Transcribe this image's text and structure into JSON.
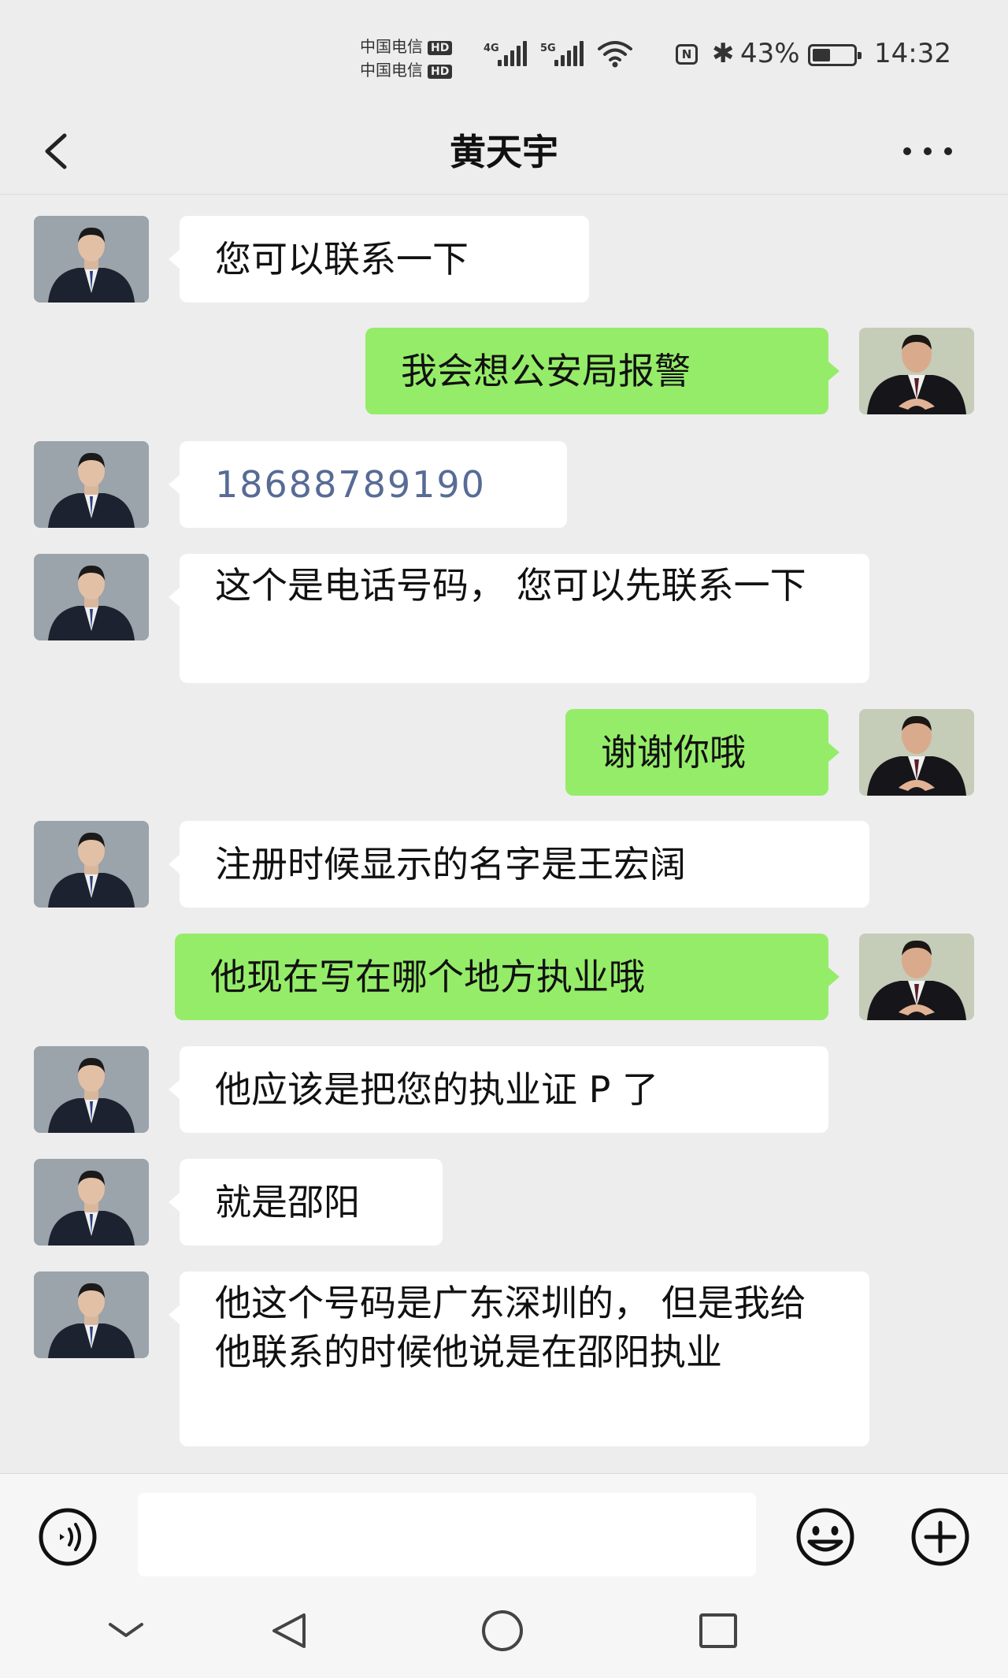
{
  "status_bar": {
    "carrier1": "中国电信",
    "carrier2": "中国电信",
    "hd": "HD",
    "sig1_tag": "4G",
    "sig2_tag": "5G",
    "nfc": "N",
    "bluetooth": "✱",
    "battery_pct": "43%",
    "battery_level": 0.43,
    "time": "14:32"
  },
  "header": {
    "title": "黄天宇"
  },
  "messages": [
    {
      "side": "in",
      "text": "您可以联系一下"
    },
    {
      "side": "out",
      "text": "我会想公安局报警"
    },
    {
      "side": "in",
      "text": "18688789190"
    },
    {
      "side": "in",
      "text": "这个是电话号码，  您可以先联系一下"
    },
    {
      "side": "out",
      "text": "谢谢你哦"
    },
    {
      "side": "in",
      "text": "注册时候显示的名字是王宏阔"
    },
    {
      "side": "out",
      "text": "他现在写在哪个地方执业哦"
    },
    {
      "side": "in",
      "text": "他应该是把您的执业证 P 了"
    },
    {
      "side": "in",
      "text": "就是邵阳"
    },
    {
      "side": "in",
      "text": "他这个号码是广东深圳的，  但是我给他联系的时候他说是在邵阳执业"
    }
  ],
  "input": {
    "value": "",
    "placeholder": ""
  },
  "colors": {
    "background": "#ededed",
    "incoming_bubble": "#ffffff",
    "outgoing_bubble": "#95ec69",
    "link": "#576b95"
  },
  "icons": {
    "back": "chevron-left-icon",
    "more": "more-dots-icon",
    "voice": "voice-icon",
    "emoji": "emoji-icon",
    "plus": "plus-icon",
    "nav_down": "chevron-down-icon",
    "nav_back": "triangle-back-icon",
    "nav_home": "circle-home-icon",
    "nav_recent": "square-recent-icon"
  }
}
